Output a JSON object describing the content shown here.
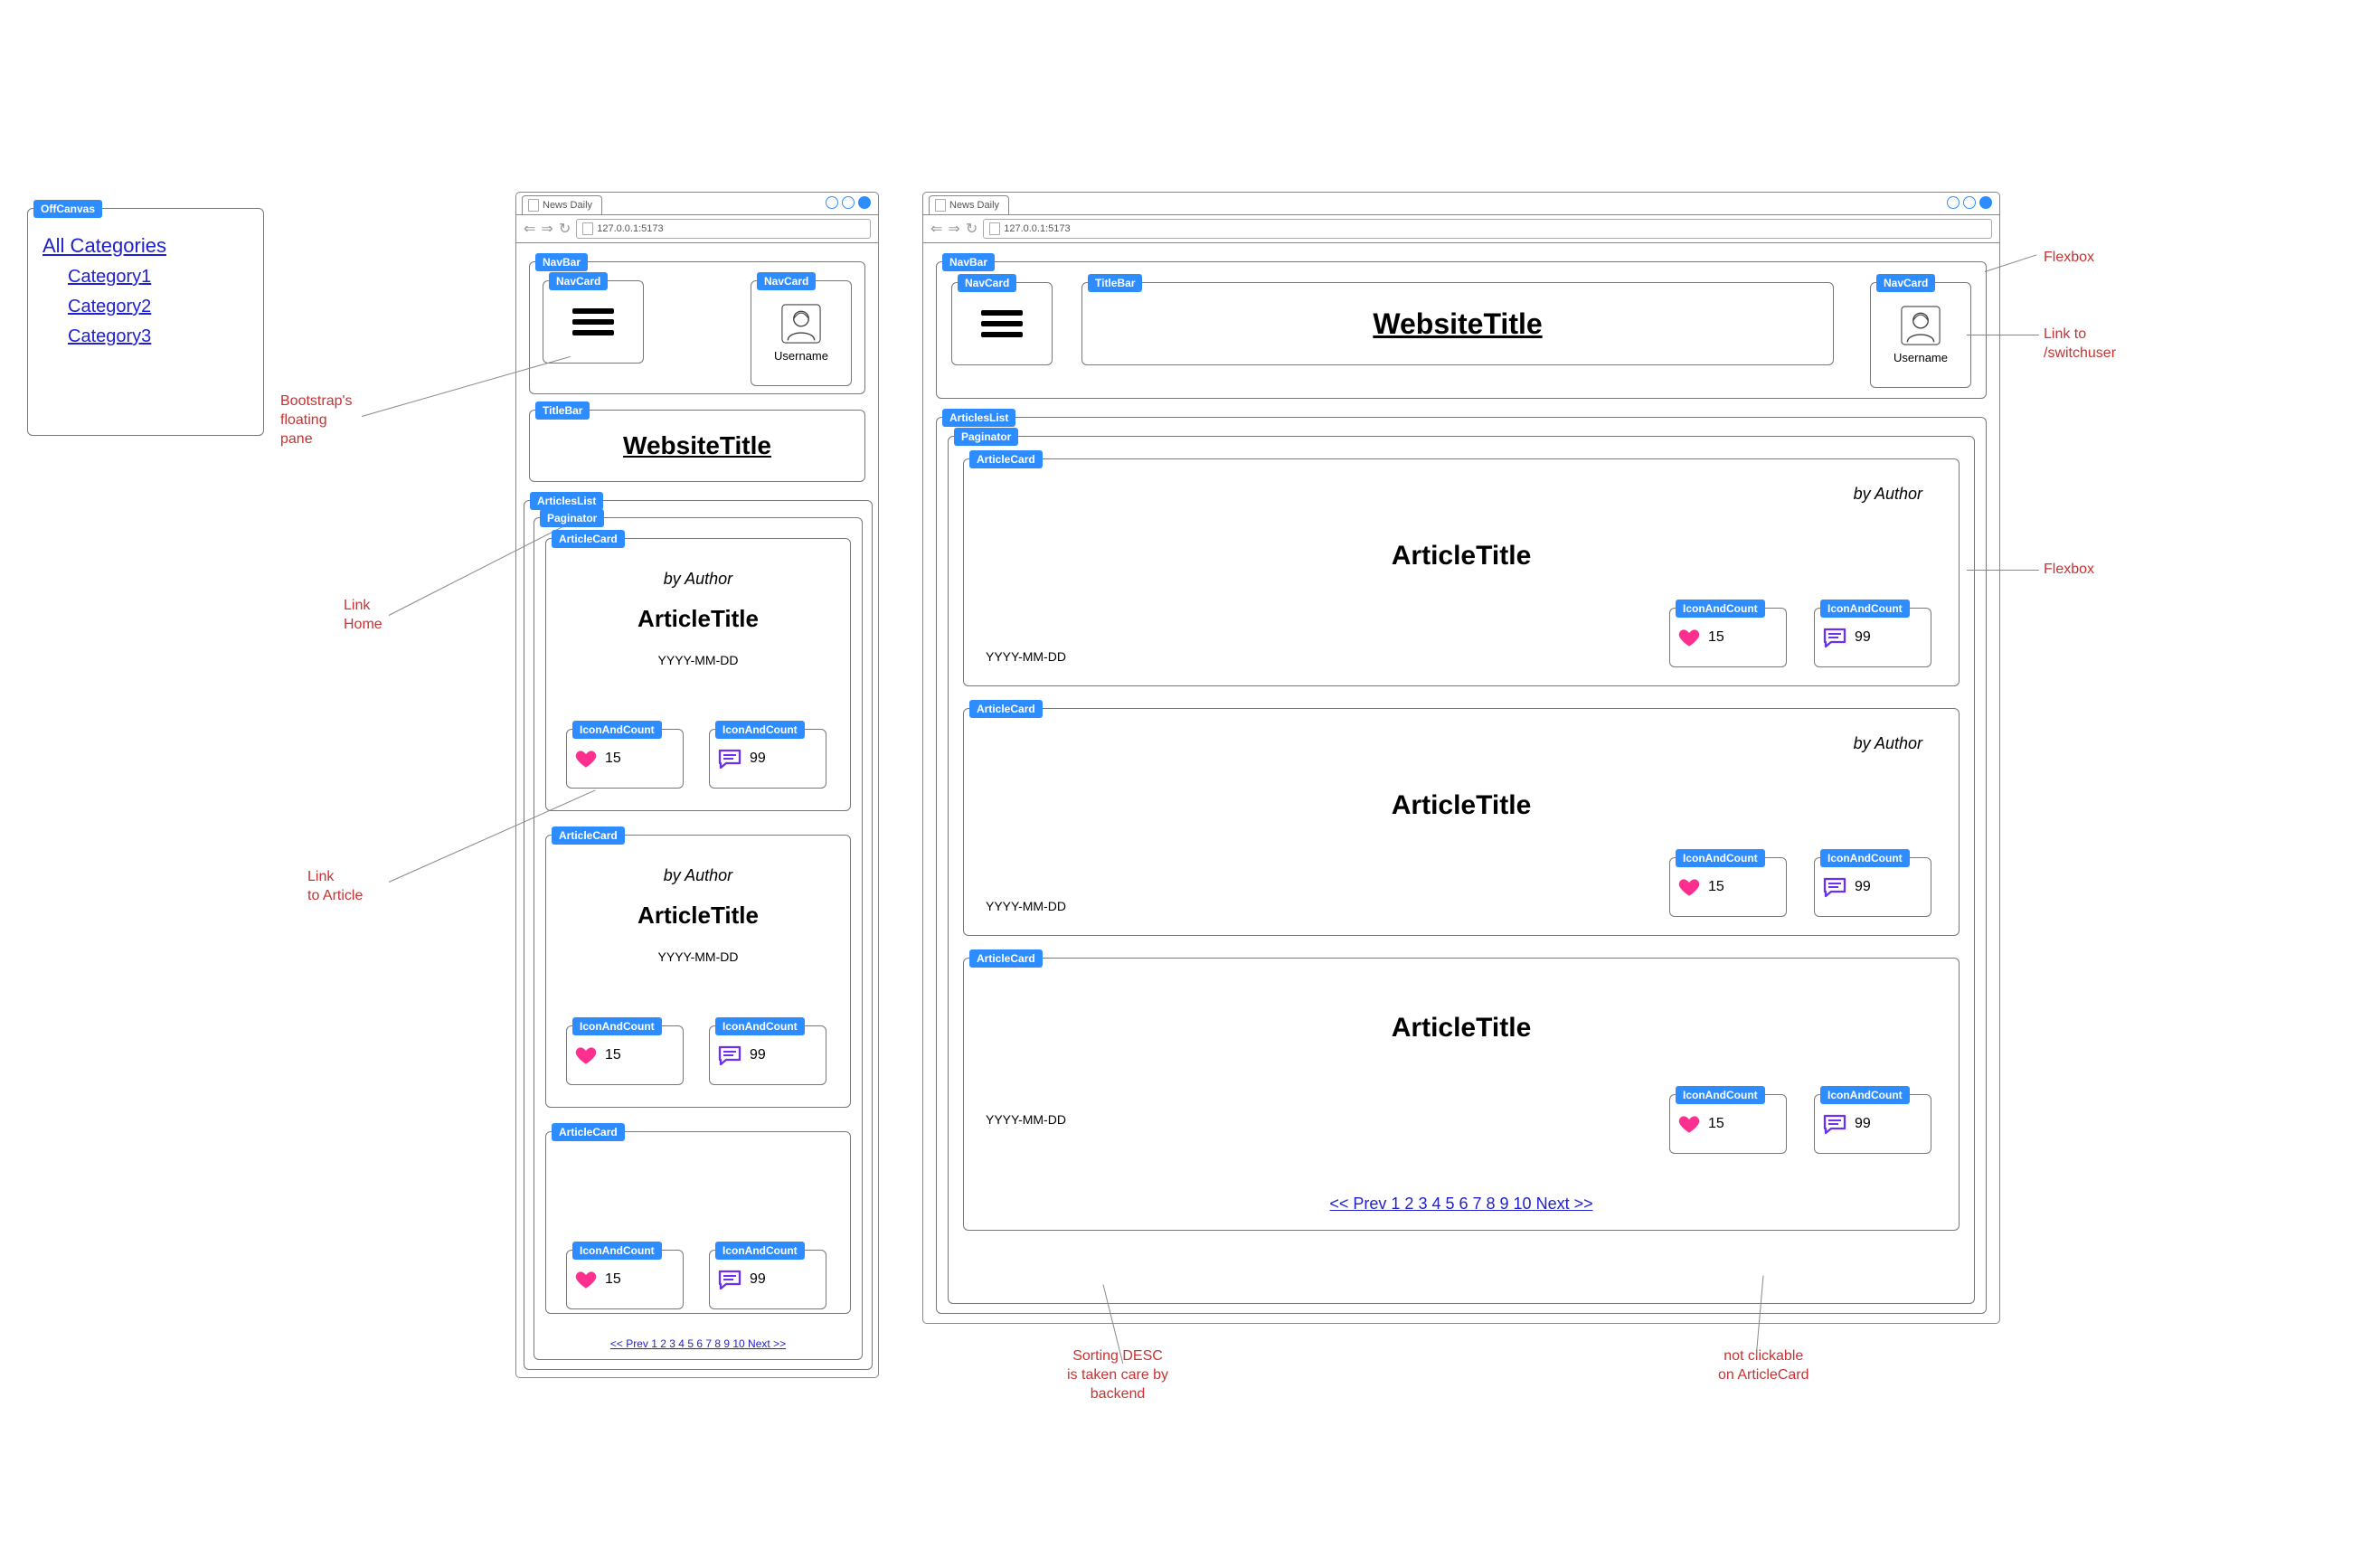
{
  "offcanvas": {
    "tag": "OffCanvas",
    "all": "All Categories",
    "cat1": "Category1",
    "cat2": "Category2",
    "cat3": "Category3"
  },
  "annotations": {
    "floating_pane": "Bootstrap's\nfloating\npane",
    "link_home": "Link\nHome",
    "link_article": "Link\nto Article",
    "flexbox": "Flexbox",
    "link_switchuser": "Link to\n/switchuser",
    "sorting": "Sorting DESC\nis taken care by\nbackend",
    "not_clickable": "not clickable\non ArticleCard"
  },
  "browser": {
    "tab_title": "News Daily",
    "url": "127.0.0.1:5173"
  },
  "tags": {
    "navbar": "NavBar",
    "navcard": "NavCard",
    "titlebar": "TitleBar",
    "articles_list": "ArticlesList",
    "paginator": "Paginator",
    "article_card": "ArticleCard",
    "icon_and_count": "IconAndCount"
  },
  "common": {
    "website_title": "WebsiteTitle",
    "username": "Username",
    "article_title": "ArticleTitle",
    "byline": "by Author",
    "date": "YYYY-MM-DD",
    "likes": "15",
    "comments": "99"
  },
  "pagination": {
    "prev": "<< Prev",
    "pages": "1 2 3 4 5 6 7 8 9 10",
    "next": "Next >>"
  }
}
